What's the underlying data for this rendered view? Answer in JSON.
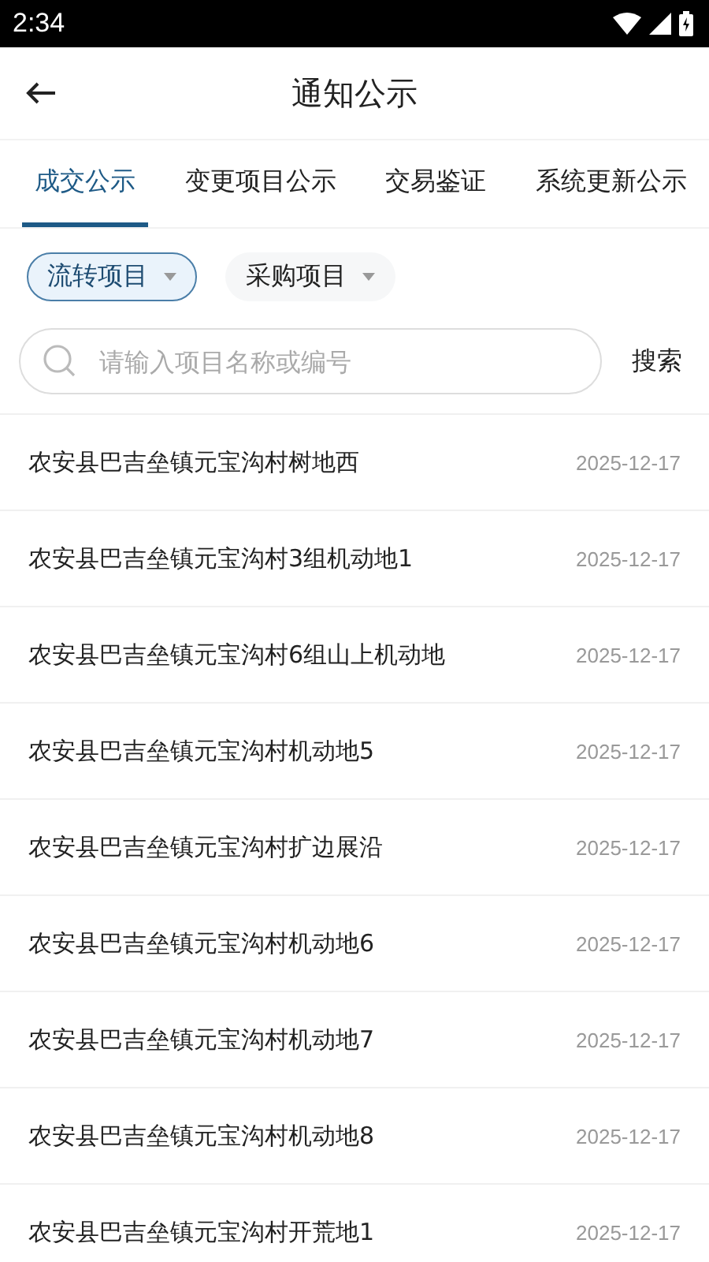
{
  "status_bar": {
    "time": "2:34"
  },
  "header": {
    "title": "通知公示"
  },
  "tabs": [
    {
      "label": "成交公示",
      "selected": true
    },
    {
      "label": "变更项目公示",
      "selected": false
    },
    {
      "label": "交易鉴证",
      "selected": false
    },
    {
      "label": "系统更新公示",
      "selected": false
    }
  ],
  "filters": [
    {
      "label": "流转项目",
      "selected": true
    },
    {
      "label": "采购项目",
      "selected": false
    }
  ],
  "search": {
    "placeholder": "请输入项目名称或编号",
    "button": "搜索"
  },
  "items": [
    {
      "title": "农安县巴吉垒镇元宝沟村树地西",
      "date": "2025-12-17"
    },
    {
      "title": "农安县巴吉垒镇元宝沟村3组机动地1",
      "date": "2025-12-17"
    },
    {
      "title": "农安县巴吉垒镇元宝沟村6组山上机动地",
      "date": "2025-12-17"
    },
    {
      "title": "农安县巴吉垒镇元宝沟村机动地5",
      "date": "2025-12-17"
    },
    {
      "title": "农安县巴吉垒镇元宝沟村扩边展沿",
      "date": "2025-12-17"
    },
    {
      "title": "农安县巴吉垒镇元宝沟村机动地6",
      "date": "2025-12-17"
    },
    {
      "title": "农安县巴吉垒镇元宝沟村机动地7",
      "date": "2025-12-17"
    },
    {
      "title": "农安县巴吉垒镇元宝沟村机动地8",
      "date": "2025-12-17"
    },
    {
      "title": "农安县巴吉垒镇元宝沟村开荒地1",
      "date": "2025-12-17"
    }
  ]
}
